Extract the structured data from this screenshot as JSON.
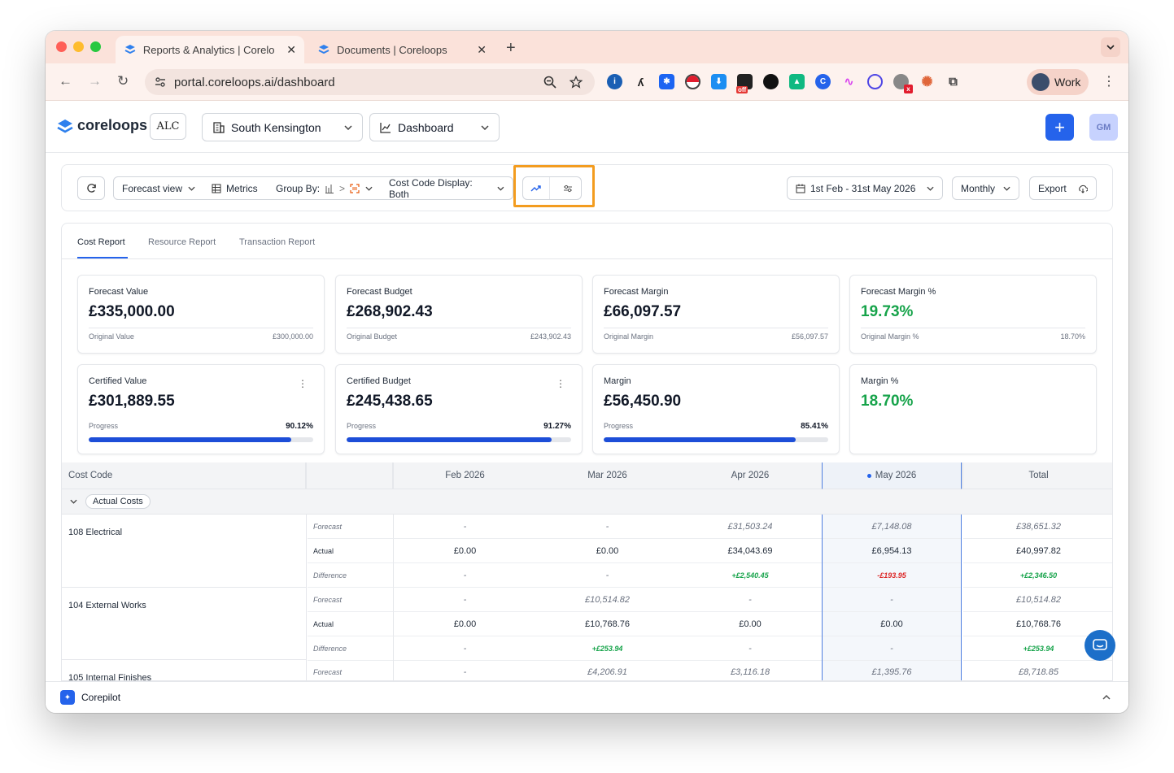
{
  "browser": {
    "tabs": [
      {
        "title": "Reports & Analytics | Corelo",
        "close": "✕"
      },
      {
        "title": "Documents | Coreloops",
        "close": "✕"
      }
    ],
    "new_tab": "+",
    "url": "portal.coreloops.ai/dashboard",
    "profile_label": "Work",
    "extension_badge": "off"
  },
  "header": {
    "brand": "coreloops",
    "client_logo": "ALC",
    "site_selector": "South Kensington",
    "view_selector": "Dashboard",
    "avatar_initials": "GM"
  },
  "toolbar": {
    "forecast_view": "Forecast view",
    "metrics": "Metrics",
    "group_by": "Group By:",
    "group_sep": ">",
    "cost_code_display": "Cost Code Display: Both",
    "date_range": "1st Feb - 31st May 2026",
    "interval": "Monthly",
    "export": "Export"
  },
  "report_tabs": [
    "Cost Report",
    "Resource Report",
    "Transaction Report"
  ],
  "kpis_top": [
    {
      "label": "Forecast Value",
      "value": "£335,000.00",
      "sub_label": "Original Value",
      "sub_value": "£300,000.00"
    },
    {
      "label": "Forecast Budget",
      "value": "£268,902.43",
      "sub_label": "Original Budget",
      "sub_value": "£243,902.43"
    },
    {
      "label": "Forecast Margin",
      "value": "£66,097.57",
      "sub_label": "Original Margin",
      "sub_value": "£56,097.57"
    },
    {
      "label": "Forecast Margin %",
      "value": "19.73%",
      "sub_label": "Original Margin %",
      "sub_value": "18.70%"
    }
  ],
  "kpis_bottom": [
    {
      "label": "Certified Value",
      "value": "£301,889.55",
      "progress_label": "Progress",
      "progress_text": "90.12%",
      "progress": 0.9012
    },
    {
      "label": "Certified Budget",
      "value": "£245,438.65",
      "progress_label": "Progress",
      "progress_text": "91.27%",
      "progress": 0.9127
    },
    {
      "label": "Margin",
      "value": "£56,450.90",
      "progress_label": "Progress",
      "progress_text": "85.41%",
      "progress": 0.8541
    },
    {
      "label": "Margin %",
      "value": "18.70%"
    }
  ],
  "table": {
    "headers": {
      "cost_code": "Cost Code",
      "feb": "Feb 2026",
      "mar": "Mar 2026",
      "apr": "Apr 2026",
      "may": "May 2026",
      "total": "Total"
    },
    "group": "Actual Costs",
    "rows": [
      {
        "code": "108 Electrical",
        "forecast": {
          "label": "Forecast",
          "feb": "-",
          "mar": "-",
          "apr": "£31,503.24",
          "may": "£7,148.08",
          "total": "£38,651.32"
        },
        "actual": {
          "label": "Actual",
          "feb": "£0.00",
          "mar": "£0.00",
          "apr": "£34,043.69",
          "may": "£6,954.13",
          "total": "£40,997.82"
        },
        "difference": {
          "label": "Difference",
          "feb": "-",
          "mar": "-",
          "apr": "+£2,540.45",
          "may": "-£193.95",
          "total": "+£2,346.50"
        }
      },
      {
        "code": "104 External Works",
        "forecast": {
          "label": "Forecast",
          "feb": "-",
          "mar": "£10,514.82",
          "apr": "-",
          "may": "-",
          "total": "£10,514.82"
        },
        "actual": {
          "label": "Actual",
          "feb": "£0.00",
          "mar": "£10,768.76",
          "apr": "£0.00",
          "may": "£0.00",
          "total": "£10,768.76"
        },
        "difference": {
          "label": "Difference",
          "feb": "-",
          "mar": "+£253.94",
          "apr": "-",
          "may": "-",
          "total": "+£253.94"
        }
      },
      {
        "code": "105 Internal Finishes",
        "forecast": {
          "label": "Forecast",
          "feb": "-",
          "mar": "£4,206.91",
          "apr": "£3,116.18",
          "may": "£1,395.76",
          "total": "£8,718.85"
        }
      }
    ]
  },
  "corepilot": "Corepilot"
}
